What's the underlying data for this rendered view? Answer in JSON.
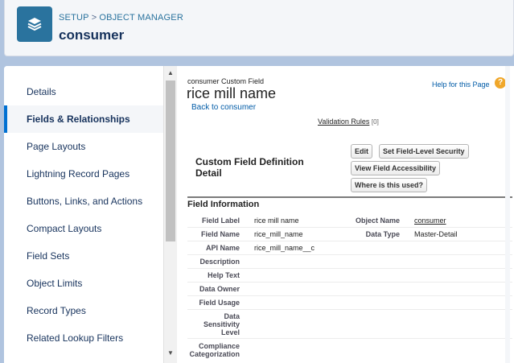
{
  "header": {
    "breadcrumb_setup": "SETUP",
    "breadcrumb_separator": ">",
    "breadcrumb_object_manager": "OBJECT MANAGER",
    "title": "consumer",
    "icon": "layers-icon",
    "icon_color": "#2a739e"
  },
  "sidebar": {
    "items": [
      {
        "label": "Details",
        "active": false
      },
      {
        "label": "Fields & Relationships",
        "active": true
      },
      {
        "label": "Page Layouts",
        "active": false
      },
      {
        "label": "Lightning Record Pages",
        "active": false
      },
      {
        "label": "Buttons, Links, and Actions",
        "active": false
      },
      {
        "label": "Compact Layouts",
        "active": false
      },
      {
        "label": "Field Sets",
        "active": false
      },
      {
        "label": "Object Limits",
        "active": false
      },
      {
        "label": "Record Types",
        "active": false
      },
      {
        "label": "Related Lookup Filters",
        "active": false
      }
    ],
    "accent_color": "#0070d2"
  },
  "content": {
    "object_label": "consumer Custom Field",
    "field_title": "rice mill name",
    "back_link": "Back to consumer",
    "help_link": "Help for this Page",
    "help_icon": "question-icon",
    "validation_rules_label": "Validation Rules",
    "validation_rules_count": "[0]",
    "definition_title": "Custom Field Definition Detail",
    "buttons": {
      "edit": "Edit",
      "set_security": "Set Field-Level Security",
      "view_accessibility": "View Field Accessibility",
      "where_used": "Where is this used?"
    },
    "section_title": "Field Information",
    "rows": [
      {
        "label": "Field Label",
        "value": "rice mill name",
        "label2": "Object Name",
        "value2": "consumer"
      },
      {
        "label": "Field Name",
        "value": "rice_mill_name",
        "label2": "Data Type",
        "value2": "Master-Detail"
      },
      {
        "label": "API Name",
        "value": "rice_mill_name__c"
      },
      {
        "label": "Description",
        "value": ""
      },
      {
        "label": "Help Text",
        "value": ""
      },
      {
        "label": "Data Owner",
        "value": ""
      },
      {
        "label": "Field Usage",
        "value": ""
      },
      {
        "label": "Data Sensitivity Level",
        "value": ""
      },
      {
        "label": "Compliance Categorization",
        "value": ""
      }
    ]
  }
}
